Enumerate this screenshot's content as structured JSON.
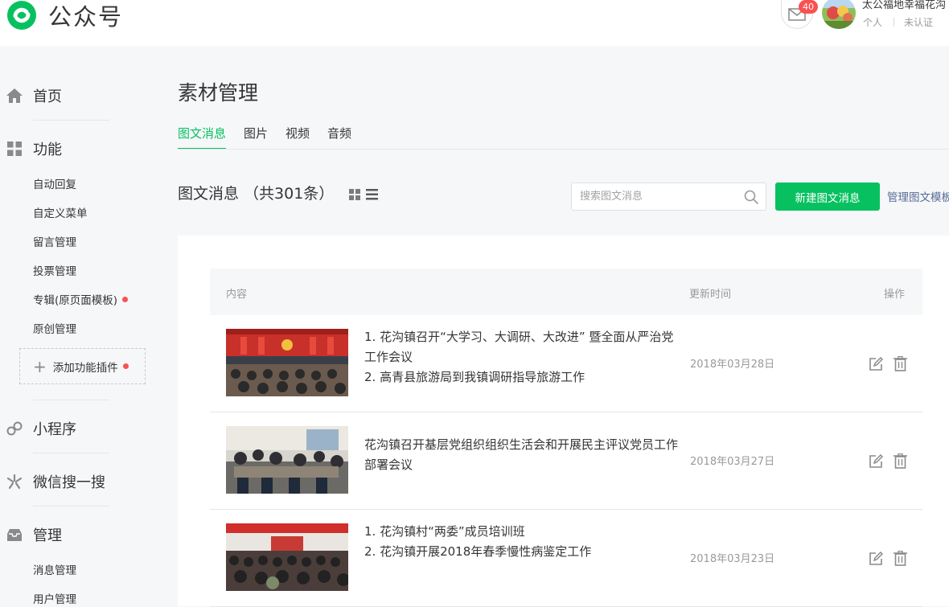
{
  "header": {
    "brand": "公众号",
    "mail_count": "40",
    "account_name": "太公福地幸福花沟",
    "account_type": "个人",
    "verify_status": "未认证"
  },
  "sidebar": {
    "home": "首页",
    "features": {
      "label": "功能",
      "items": [
        "自动回复",
        "自定义菜单",
        "留言管理",
        "投票管理",
        "专辑(原页面模板)",
        "原创管理"
      ],
      "add_plugin": "添加功能插件"
    },
    "mini_program": "小程序",
    "wechat_search": "微信搜一搜",
    "management": {
      "label": "管理",
      "items": [
        "消息管理",
        "用户管理"
      ]
    }
  },
  "main": {
    "title": "素材管理",
    "tabs": [
      "图文消息",
      "图片",
      "视频",
      "音频"
    ],
    "active_tab": "图文消息",
    "section_title": "图文消息 （共301条）",
    "search_placeholder": "搜索图文消息",
    "new_button": "新建图文消息",
    "manage_link": "管理图文模板",
    "table": {
      "columns": [
        "内容",
        "更新时间",
        "操作"
      ],
      "rows": [
        {
          "lines": [
            "1. 花沟镇召开“大学习、大调研、大改进” 暨全面从严治党工作会议",
            "2. 高青县旅游局到我镇调研指导旅游工作"
          ],
          "date": "2018年03月28日"
        },
        {
          "lines": [
            "花沟镇召开基层党组织组织生活会和开展民主评议党员工作部署会议"
          ],
          "date": "2018年03月27日"
        },
        {
          "lines": [
            "1. 花沟镇村“两委”成员培训班",
            "2. 花沟镇开展2018年春季慢性病鉴定工作"
          ],
          "date": "2018年03月23日"
        }
      ]
    }
  },
  "colors": {
    "accent": "#07c160",
    "badge": "#fa5151",
    "link": "#576b95"
  }
}
